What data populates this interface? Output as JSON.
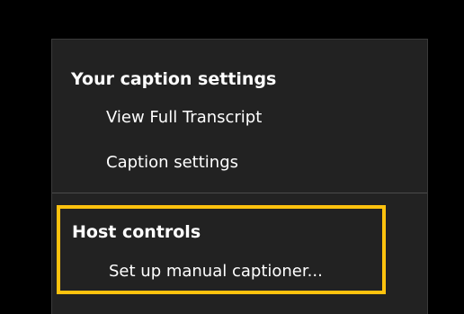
{
  "caption_menu": {
    "your_settings_heading": "Your caption settings",
    "items": [
      {
        "label": "View Full Transcript"
      },
      {
        "label": "Caption settings"
      }
    ],
    "host_controls_heading": "Host controls",
    "host_items": [
      {
        "label": "Set up manual captioner..."
      }
    ]
  },
  "colors": {
    "highlight_border": "#ffc20e",
    "menu_background": "#222222",
    "page_background": "#000000"
  }
}
